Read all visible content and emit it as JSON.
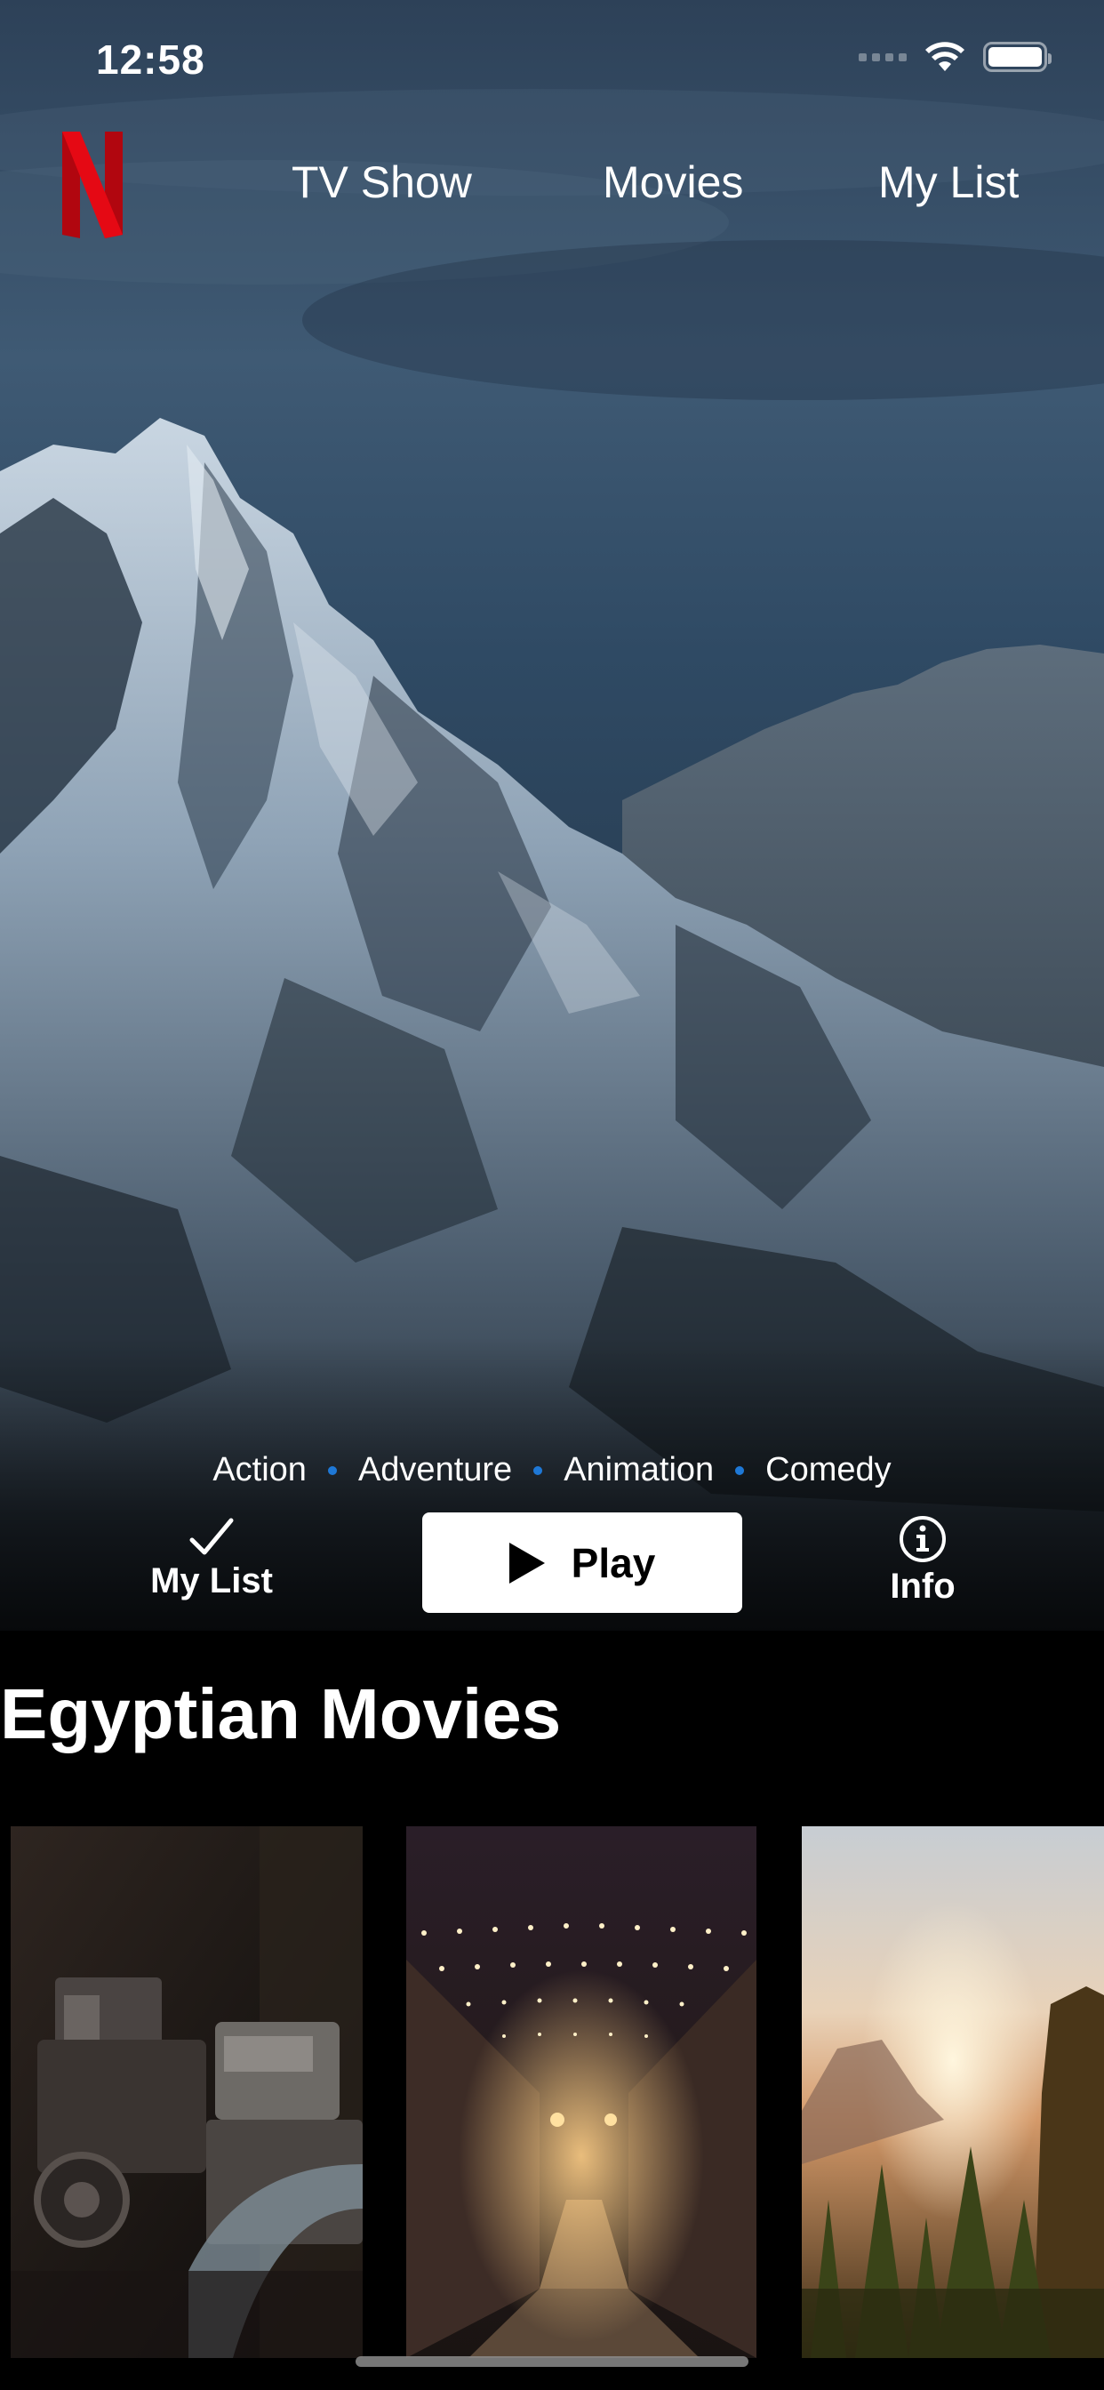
{
  "status_bar": {
    "time": "12:58"
  },
  "nav": {
    "logo": "N",
    "tabs": [
      {
        "label": "TV Show"
      },
      {
        "label": "Movies"
      },
      {
        "label": "My List"
      }
    ]
  },
  "hero": {
    "genres": [
      "Action",
      "Adventure",
      "Animation",
      "Comedy"
    ],
    "my_list_label": "My List",
    "play_label": "Play",
    "info_label": "Info"
  },
  "section": {
    "title": "Egyptian Movies",
    "posters": [
      {
        "subject": "vintage-machinery"
      },
      {
        "subject": "lit-alley-at-night"
      },
      {
        "subject": "sunset-forest-mountains"
      }
    ]
  },
  "colors": {
    "brand_red": "#e50914",
    "genre_dot": "#1e78d6",
    "background": "#000000"
  }
}
